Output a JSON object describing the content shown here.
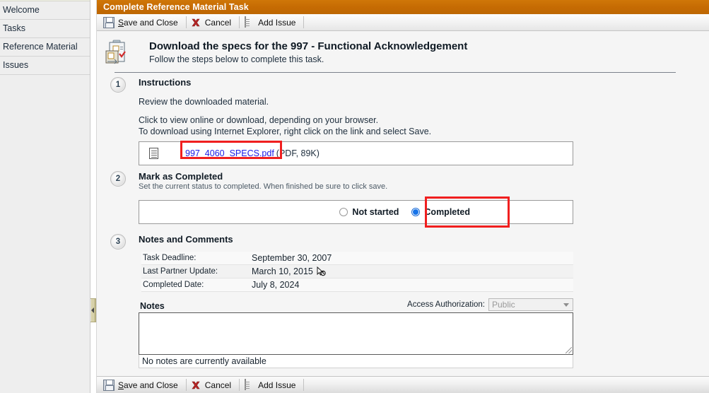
{
  "sidebar": {
    "items": [
      {
        "label": "Welcome",
        "name": "sidebar-item-welcome"
      },
      {
        "label": "Tasks",
        "name": "sidebar-item-tasks"
      },
      {
        "label": "Reference Material",
        "name": "sidebar-item-reference-material"
      },
      {
        "label": "Issues",
        "name": "sidebar-item-issues"
      }
    ]
  },
  "window": {
    "title": "Complete Reference Material Task",
    "title_bar_color": "#c66b03"
  },
  "toolbar": {
    "save_label_accel": "S",
    "save_label_rest": "ave and Close",
    "cancel_label": "Cancel",
    "add_issue_label": "Add Issue"
  },
  "task": {
    "title": "Download the specs for the 997 - Functional Acknowledgement",
    "subtitle": "Follow the steps below to complete this task."
  },
  "steps": [
    {
      "number": "1",
      "title": "Instructions",
      "line1": "Review the downloaded material.",
      "line2": "Click to view online or download, depending on your browser.",
      "line3": "To download using Internet Explorer, right click on the link and select Save.",
      "file_link": "997_4060_SPECS.pdf",
      "file_meta": "(PDF, 89K)"
    },
    {
      "number": "2",
      "title": "Mark as Completed",
      "subtitle": "Set the current status to completed. When finished be sure to click save.",
      "options": [
        {
          "label": "Not started",
          "selected": false
        },
        {
          "label": "Completed",
          "selected": true
        }
      ]
    },
    {
      "number": "3",
      "title": "Notes and Comments",
      "meta_rows": [
        {
          "key": "Task Deadline:",
          "value": "September 30, 2007"
        },
        {
          "key": "Last Partner Update:",
          "value": "March 10, 2015"
        },
        {
          "key": "Completed Date:",
          "value": "July 8, 2024"
        }
      ],
      "notes_label": "Notes",
      "access_auth_label": "Access Authorization:",
      "access_auth_value": "Public",
      "notes_value": "",
      "notes_placeholder": "",
      "notes_empty_text": "No notes are currently available"
    }
  ],
  "annotations": {
    "highlight_color": "#f01f1f"
  }
}
